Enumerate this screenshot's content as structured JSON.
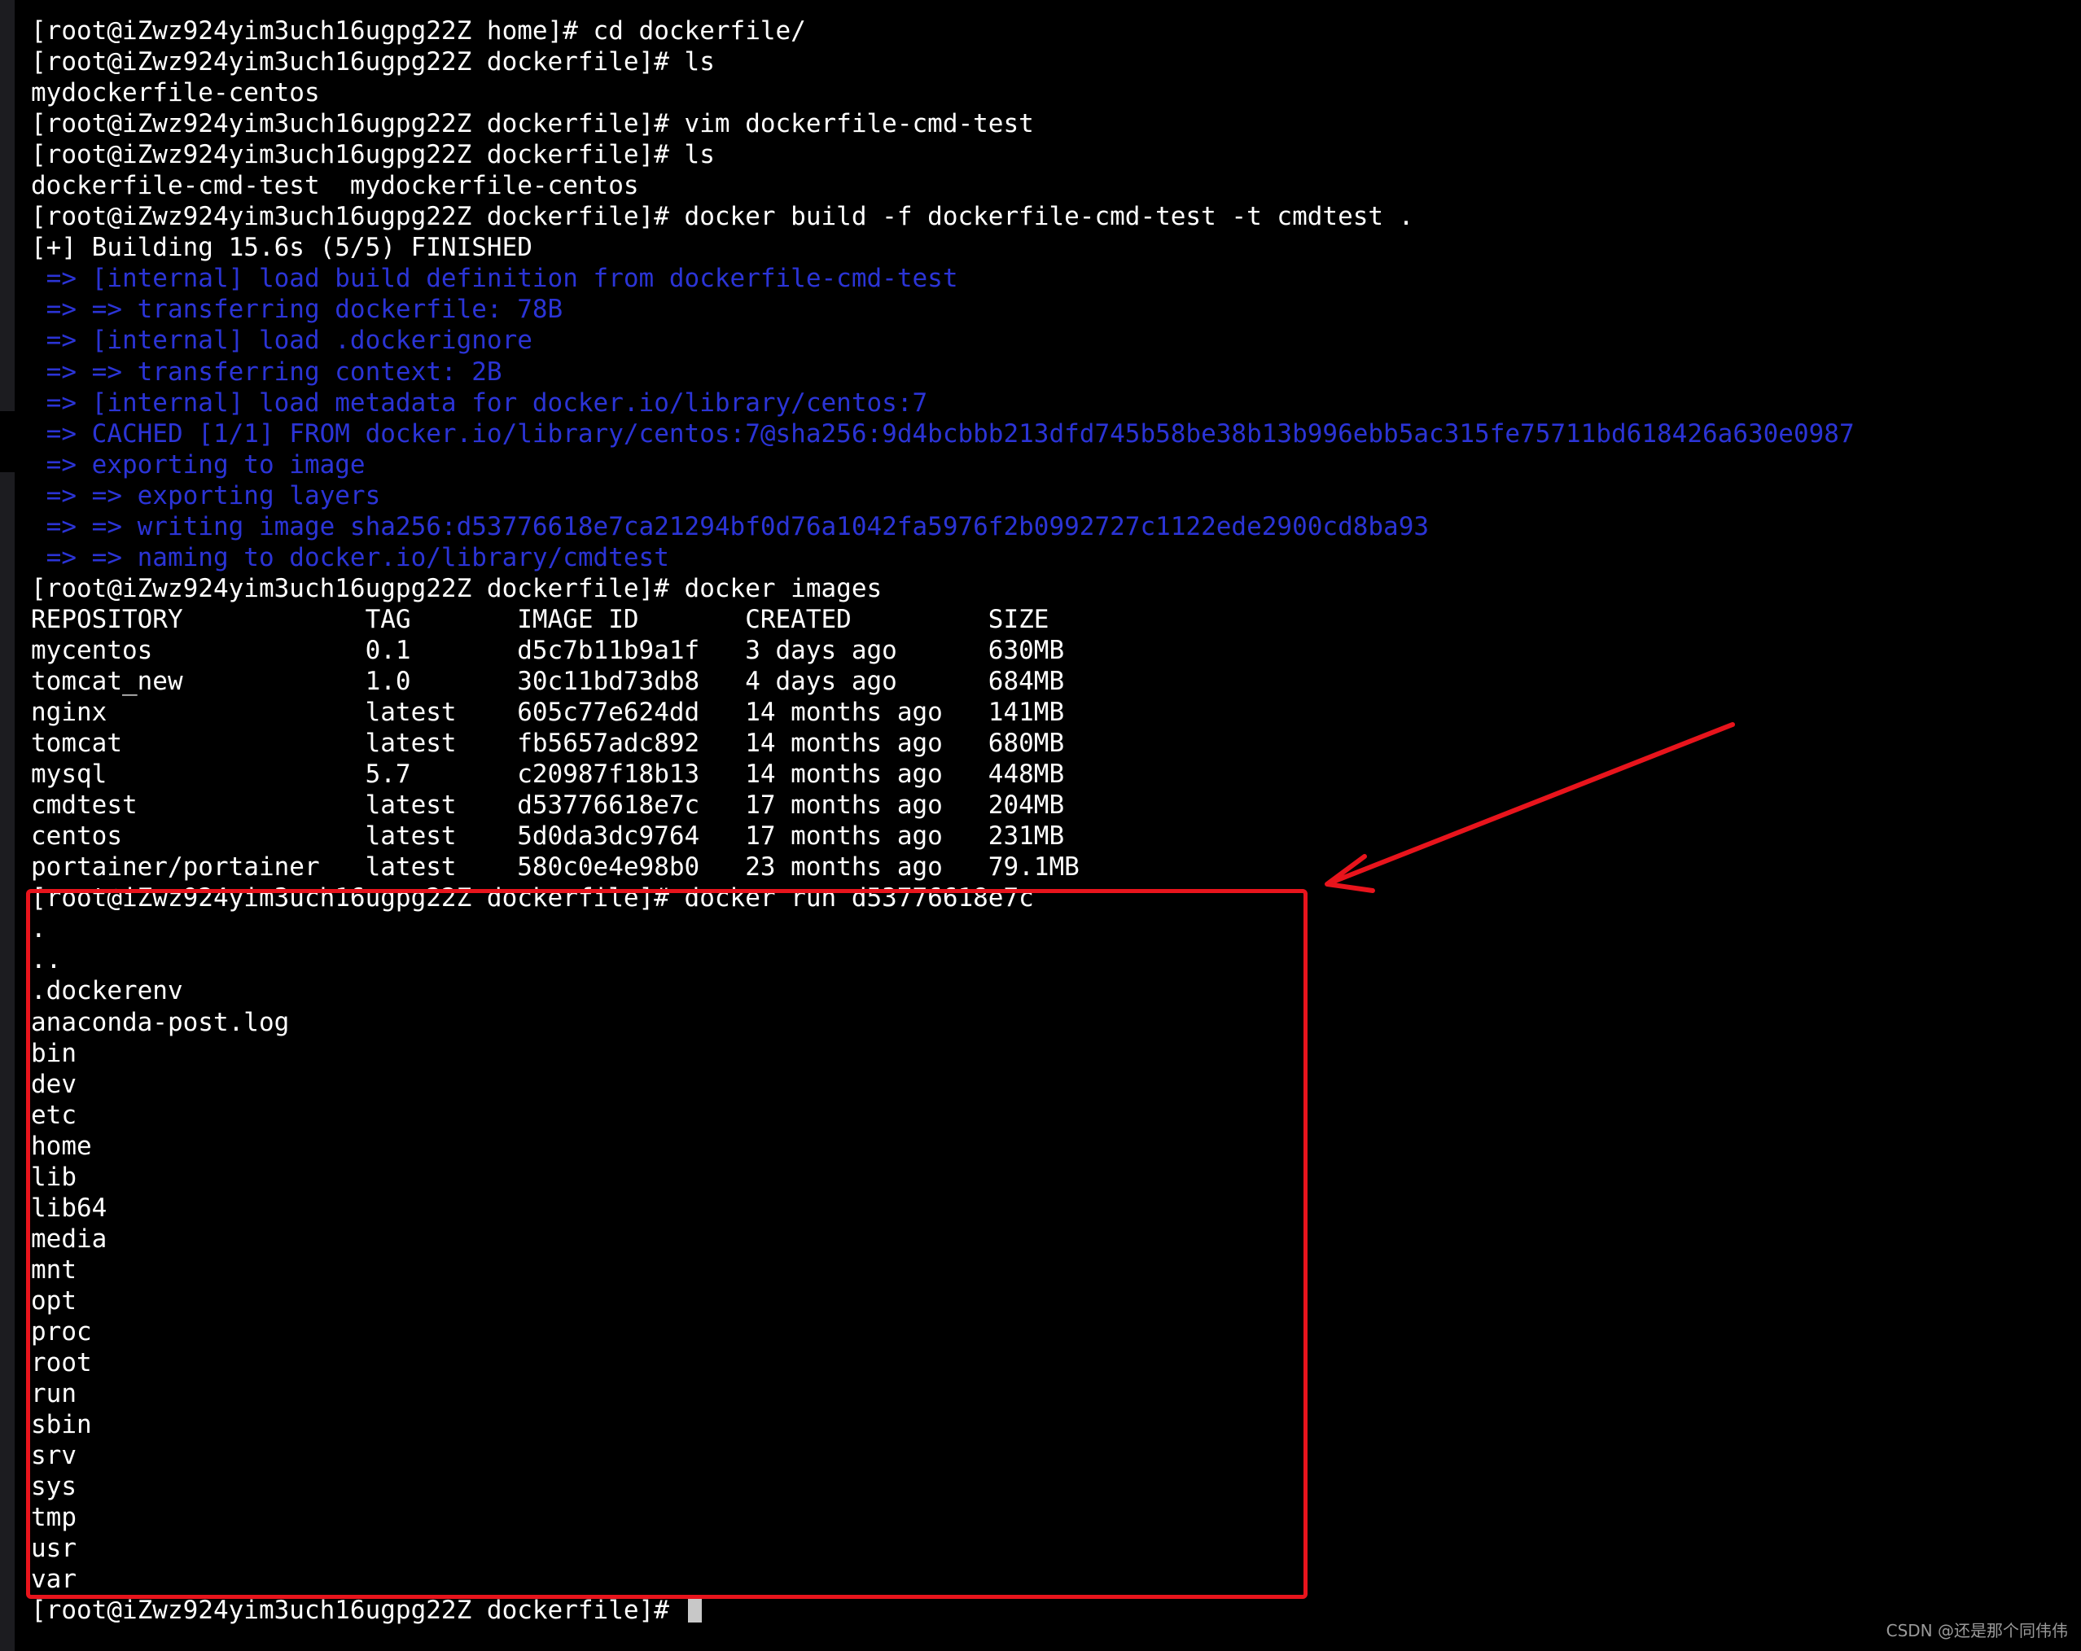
{
  "terminal": {
    "lines": [
      {
        "text": "[root@iZwz924yim3uch16ugpg22Z home]# cd dockerfile/",
        "color": "white"
      },
      {
        "text": "[root@iZwz924yim3uch16ugpg22Z dockerfile]# ls",
        "color": "white"
      },
      {
        "text": "mydockerfile-centos",
        "color": "white"
      },
      {
        "text": "[root@iZwz924yim3uch16ugpg22Z dockerfile]# vim dockerfile-cmd-test",
        "color": "white"
      },
      {
        "text": "[root@iZwz924yim3uch16ugpg22Z dockerfile]# ls",
        "color": "white"
      },
      {
        "text": "dockerfile-cmd-test  mydockerfile-centos",
        "color": "white"
      },
      {
        "text": "[root@iZwz924yim3uch16ugpg22Z dockerfile]# docker build -f dockerfile-cmd-test -t cmdtest .",
        "color": "white"
      },
      {
        "text": "[+] Building 15.6s (5/5) FINISHED",
        "color": "white"
      },
      {
        "text": " => [internal] load build definition from dockerfile-cmd-test",
        "color": "blue"
      },
      {
        "text": " => => transferring dockerfile: 78B",
        "color": "blue"
      },
      {
        "text": " => [internal] load .dockerignore",
        "color": "blue"
      },
      {
        "text": " => => transferring context: 2B",
        "color": "blue"
      },
      {
        "text": " => [internal] load metadata for docker.io/library/centos:7",
        "color": "blue"
      },
      {
        "text": " => CACHED [1/1] FROM docker.io/library/centos:7@sha256:9d4bcbbb213dfd745b58be38b13b996ebb5ac315fe75711bd618426a630e0987",
        "color": "blue"
      },
      {
        "text": " => exporting to image",
        "color": "blue"
      },
      {
        "text": " => => exporting layers",
        "color": "blue"
      },
      {
        "text": " => => writing image sha256:d53776618e7ca21294bf0d76a1042fa5976f2b0992727c1122ede2900cd8ba93",
        "color": "blue"
      },
      {
        "text": " => => naming to docker.io/library/cmdtest",
        "color": "blue"
      },
      {
        "text": "[root@iZwz924yim3uch16ugpg22Z dockerfile]# docker images",
        "color": "white"
      },
      {
        "text": "REPOSITORY            TAG       IMAGE ID       CREATED         SIZE",
        "color": "white"
      },
      {
        "text": "mycentos              0.1       d5c7b11b9a1f   3 days ago      630MB",
        "color": "white"
      },
      {
        "text": "tomcat_new            1.0       30c11bd73db8   4 days ago      684MB",
        "color": "white"
      },
      {
        "text": "nginx                 latest    605c77e624dd   14 months ago   141MB",
        "color": "white"
      },
      {
        "text": "tomcat                latest    fb5657adc892   14 months ago   680MB",
        "color": "white"
      },
      {
        "text": "mysql                 5.7       c20987f18b13   14 months ago   448MB",
        "color": "white"
      },
      {
        "text": "cmdtest               latest    d53776618e7c   17 months ago   204MB",
        "color": "white"
      },
      {
        "text": "centos                latest    5d0da3dc9764   17 months ago   231MB",
        "color": "white"
      },
      {
        "text": "portainer/portainer   latest    580c0e4e98b0   23 months ago   79.1MB",
        "color": "white"
      },
      {
        "text": "[root@iZwz924yim3uch16ugpg22Z dockerfile]# docker run d53776618e7c",
        "color": "white"
      },
      {
        "text": ".",
        "color": "white"
      },
      {
        "text": "..",
        "color": "white"
      },
      {
        "text": ".dockerenv",
        "color": "white"
      },
      {
        "text": "anaconda-post.log",
        "color": "white"
      },
      {
        "text": "bin",
        "color": "white"
      },
      {
        "text": "dev",
        "color": "white"
      },
      {
        "text": "etc",
        "color": "white"
      },
      {
        "text": "home",
        "color": "white"
      },
      {
        "text": "lib",
        "color": "white"
      },
      {
        "text": "lib64",
        "color": "white"
      },
      {
        "text": "media",
        "color": "white"
      },
      {
        "text": "mnt",
        "color": "white"
      },
      {
        "text": "opt",
        "color": "white"
      },
      {
        "text": "proc",
        "color": "white"
      },
      {
        "text": "root",
        "color": "white"
      },
      {
        "text": "run",
        "color": "white"
      },
      {
        "text": "sbin",
        "color": "white"
      },
      {
        "text": "srv",
        "color": "white"
      },
      {
        "text": "sys",
        "color": "white"
      },
      {
        "text": "tmp",
        "color": "white"
      },
      {
        "text": "usr",
        "color": "white"
      },
      {
        "text": "var",
        "color": "white"
      }
    ],
    "prompt": "[root@iZwz924yim3uch16ugpg22Z dockerfile]# "
  },
  "annotation": {
    "box_color": "#e8141c",
    "arrow_color": "#e8141c",
    "arrow_icon": "red-arrow-icon"
  },
  "colors": {
    "background": "#000000",
    "text": "#ffffff",
    "build_output": "#2b34d6"
  },
  "watermark": "CSDN @还是那个同伟伟"
}
